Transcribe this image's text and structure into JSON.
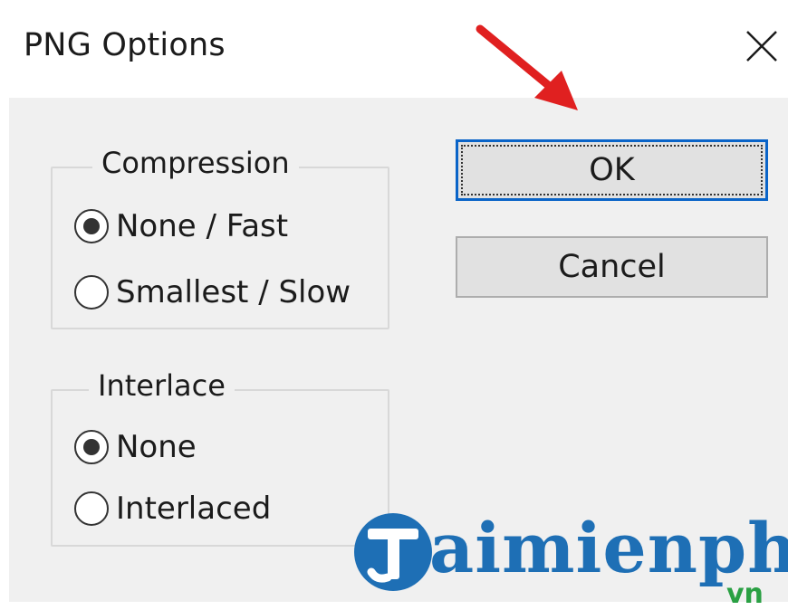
{
  "window": {
    "title": "PNG Options",
    "close_label": "✕"
  },
  "compression": {
    "legend": "Compression",
    "options": [
      {
        "label": "None / Fast",
        "checked": true
      },
      {
        "label": "Smallest / Slow",
        "checked": false
      }
    ]
  },
  "interlace": {
    "legend": "Interlace",
    "options": [
      {
        "label": "None",
        "checked": true
      },
      {
        "label": "Interlaced",
        "checked": false
      }
    ]
  },
  "buttons": {
    "ok": "OK",
    "cancel": "Cancel"
  },
  "watermark": {
    "text": "aimienphi",
    "suffix": "vn"
  },
  "colors": {
    "accent": "#0a64c8",
    "arrow": "#e02020",
    "watermark_blue": "#1e6fb5",
    "watermark_green": "#2aa043"
  }
}
